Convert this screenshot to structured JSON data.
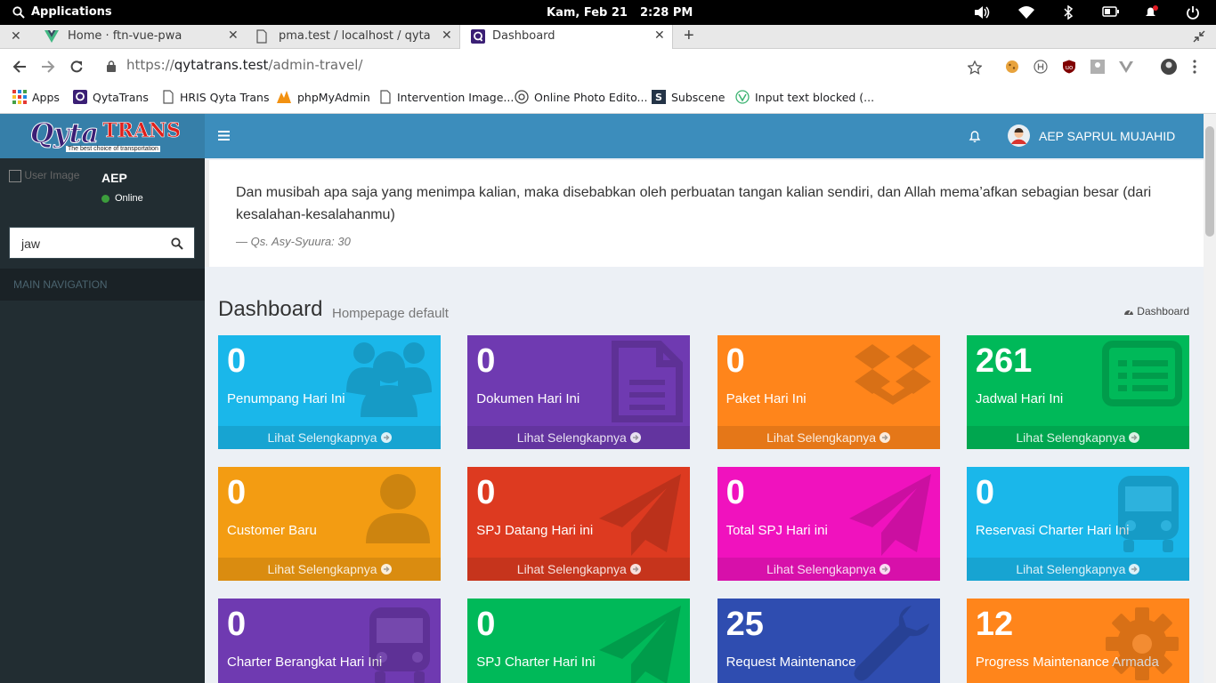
{
  "os": {
    "apps_label": "Applications",
    "day": "Kam, Feb 21",
    "time": "2:28 PM"
  },
  "browser": {
    "tabs": [
      {
        "title": "Home · ftn-vue-pwa"
      },
      {
        "title": "pma.test / localhost / qytadev /"
      },
      {
        "title": "Dashboard"
      }
    ],
    "url": {
      "proto": "https://",
      "host": "qytatrans.test",
      "path": "/admin-travel/"
    },
    "bookmarks": [
      {
        "label": "Apps"
      },
      {
        "label": "QytaTrans"
      },
      {
        "label": "HRIS Qyta Trans"
      },
      {
        "label": "phpMyAdmin"
      },
      {
        "label": "Intervention Image..."
      },
      {
        "label": "Online Photo Edito..."
      },
      {
        "label": "Subscene"
      },
      {
        "label": "Input text blocked (..."
      }
    ]
  },
  "logo": {
    "text": "Qyta",
    "text2": "TRANS",
    "tagline": "The best choice of transportation"
  },
  "navbar": {
    "user_name": "AEP SAPRUL MUJAHID"
  },
  "sidebar": {
    "user_img_alt": "User Image",
    "user": "AEP",
    "status": "Online",
    "search_value": "jaw",
    "header": "MAIN NAVIGATION"
  },
  "quote": {
    "text": "Dan musibah apa saja yang menimpa kalian, maka disebabkan oleh perbuatan tangan kalian sendiri, dan Allah mema’afkan sebagian besar (dari kesalahan-kesalahanmu)",
    "source": "— Qs. Asy-Syuura: 30"
  },
  "page": {
    "title": "Dashboard",
    "subtitle": "Hompepage default",
    "breadcrumb": "Dashboard"
  },
  "more_label": "Lihat Selengkapnya",
  "boxes": [
    {
      "value": "0",
      "label": "Penumpang Hari Ini",
      "color": "#1ab7ea",
      "icon": "users-icon"
    },
    {
      "value": "0",
      "label": "Dokumen Hari Ini",
      "color": "#6f3ab1",
      "icon": "document-icon"
    },
    {
      "value": "0",
      "label": "Paket Hari Ini",
      "color": "#ff851b",
      "icon": "dropbox-icon"
    },
    {
      "value": "261",
      "label": "Jadwal Hari Ini",
      "color": "#00b959",
      "icon": "list-alt-icon"
    },
    {
      "value": "0",
      "label": "Customer Baru",
      "color": "#f39c12",
      "icon": "user-icon"
    },
    {
      "value": "0",
      "label": "SPJ Datang Hari ini",
      "color": "#dd3a20",
      "icon": "paper-plane-icon"
    },
    {
      "value": "0",
      "label": "Total SPJ Hari ini",
      "color": "#f012be",
      "icon": "paper-plane-icon"
    },
    {
      "value": "0",
      "label": "Reservasi Charter Hari Ini",
      "color": "#1ab7ea",
      "icon": "bus-icon"
    },
    {
      "value": "0",
      "label": "Charter Berangkat Hari Ini",
      "color": "#6f3ab1",
      "icon": "bus-icon"
    },
    {
      "value": "0",
      "label": "SPJ Charter Hari Ini",
      "color": "#00b959",
      "icon": "paper-plane-icon"
    },
    {
      "value": "25",
      "label": "Request Maintenance",
      "color": "#2f4db0",
      "icon": "wrench-icon"
    },
    {
      "value": "12",
      "label": "Progress Maintenance Armada",
      "color": "#ff851b",
      "icon": "gear-icon"
    }
  ]
}
